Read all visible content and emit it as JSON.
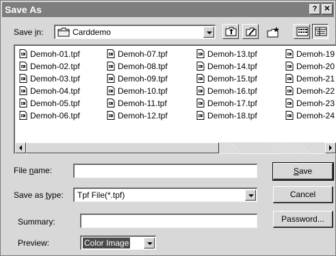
{
  "window": {
    "title": "Save As",
    "help_glyph": "?",
    "close_glyph": "✕"
  },
  "save_in": {
    "label_pre": "Save ",
    "label_key": "i",
    "label_post": "n:",
    "value": "Carddemo",
    "folder_icon": "folder-icon"
  },
  "toolbar": {
    "buttons": [
      {
        "name": "up-one-level-icon"
      },
      {
        "name": "new-folder-icon"
      },
      {
        "name": "desktop-icon"
      },
      {
        "name": "list-view-icon"
      },
      {
        "name": "details-view-icon"
      }
    ]
  },
  "files": {
    "columns": [
      [
        "Demoh-01.tpf",
        "Demoh-02.tpf",
        "Demoh-03.tpf",
        "Demoh-04.tpf",
        "Demoh-05.tpf",
        "Demoh-06.tpf"
      ],
      [
        "Demoh-07.tpf",
        "Demoh-08.tpf",
        "Demoh-09.tpf",
        "Demoh-10.tpf",
        "Demoh-11.tpf",
        "Demoh-12.tpf"
      ],
      [
        "Demoh-13.tpf",
        "Demoh-14.tpf",
        "Demoh-15.tpf",
        "Demoh-16.tpf",
        "Demoh-17.tpf",
        "Demoh-18.tpf"
      ],
      [
        "Demoh-19",
        "Demoh-20",
        "Demoh-21",
        "Demoh-22",
        "Demoh-23",
        "Demoh-24"
      ]
    ]
  },
  "form": {
    "file_name_pre": "File ",
    "file_name_key": "n",
    "file_name_post": "ame:",
    "file_name_value": "",
    "save_type_pre": "Save as ",
    "save_type_key": "t",
    "save_type_post": "ype:",
    "save_type_value": "Tpf File(*.tpf)",
    "summary_label": "Summary:",
    "summary_value": "",
    "preview_label": "Preview:",
    "preview_value": "Color Image"
  },
  "buttons": {
    "save_key": "S",
    "save_rest": "ave",
    "cancel": "Cancel",
    "password": "Password..."
  }
}
